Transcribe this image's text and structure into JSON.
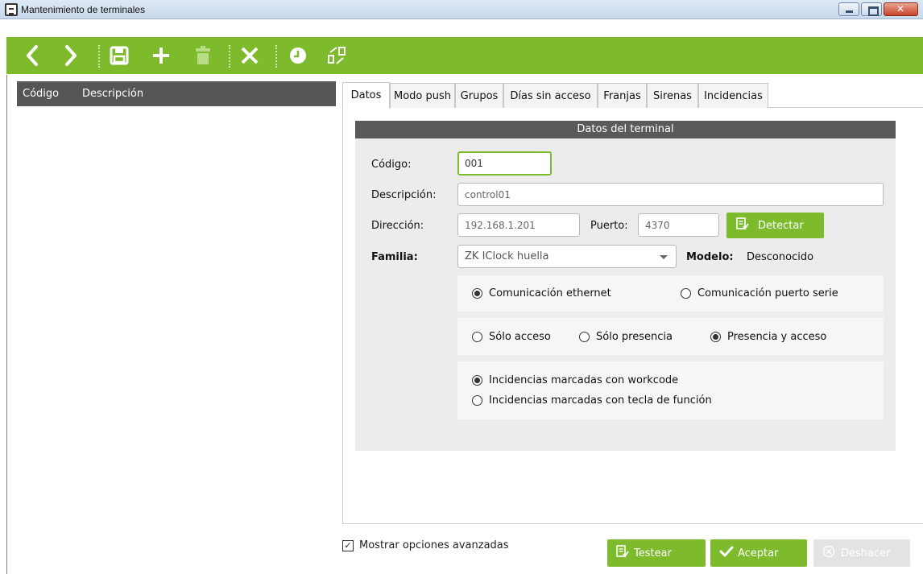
{
  "window": {
    "title": "Mantenimiento de terminales"
  },
  "toolbar": {
    "icons": [
      "chevron-left-icon",
      "chevron-right-icon",
      "save-icon",
      "plus-icon",
      "trash-icon",
      "close-icon",
      "clock-icon",
      "transfer-icon"
    ]
  },
  "list": {
    "columns": [
      "Código",
      "Descripción"
    ]
  },
  "tabs": [
    {
      "label": "Datos",
      "active": true
    },
    {
      "label": "Modo push"
    },
    {
      "label": "Grupos"
    },
    {
      "label": "Días sin acceso"
    },
    {
      "label": "Franjas"
    },
    {
      "label": "Sirenas"
    },
    {
      "label": "Incidencias"
    }
  ],
  "panel": {
    "header": "Datos del terminal",
    "codigo": {
      "label": "Código:",
      "value": "001"
    },
    "descripcion": {
      "label": "Descripción:",
      "value": "control01"
    },
    "direccion": {
      "label": "Dirección:",
      "value": "192.168.1.201"
    },
    "puerto": {
      "label": "Puerto:",
      "value": "4370"
    },
    "detectar": {
      "label": "Detectar"
    },
    "familia": {
      "label": "Familia:",
      "value": "ZK IClock huella"
    },
    "modelo": {
      "label": "Modelo:",
      "value": "Desconocido"
    },
    "comunicacion": {
      "ethernet": "Comunicación ethernet",
      "serie": "Comunicación puerto serie",
      "selected": "ethernet"
    },
    "modo": {
      "solo_acceso": "Sólo acceso",
      "solo_presencia": "Sólo presencia",
      "presencia_acceso": "Presencia y acceso",
      "selected": "presencia_acceso"
    },
    "incidencias": {
      "workcode": "Incidencias marcadas con workcode",
      "tecla": "Incidencias marcadas con tecla de función",
      "selected": "workcode"
    }
  },
  "footer": {
    "advanced": {
      "label": "Mostrar opciones avanzadas",
      "checked": true
    },
    "testear": "Testear",
    "aceptar": "Aceptar",
    "deshacer": "Deshacer"
  },
  "colors": {
    "accent": "#7dbb2d",
    "header": "#555555"
  }
}
